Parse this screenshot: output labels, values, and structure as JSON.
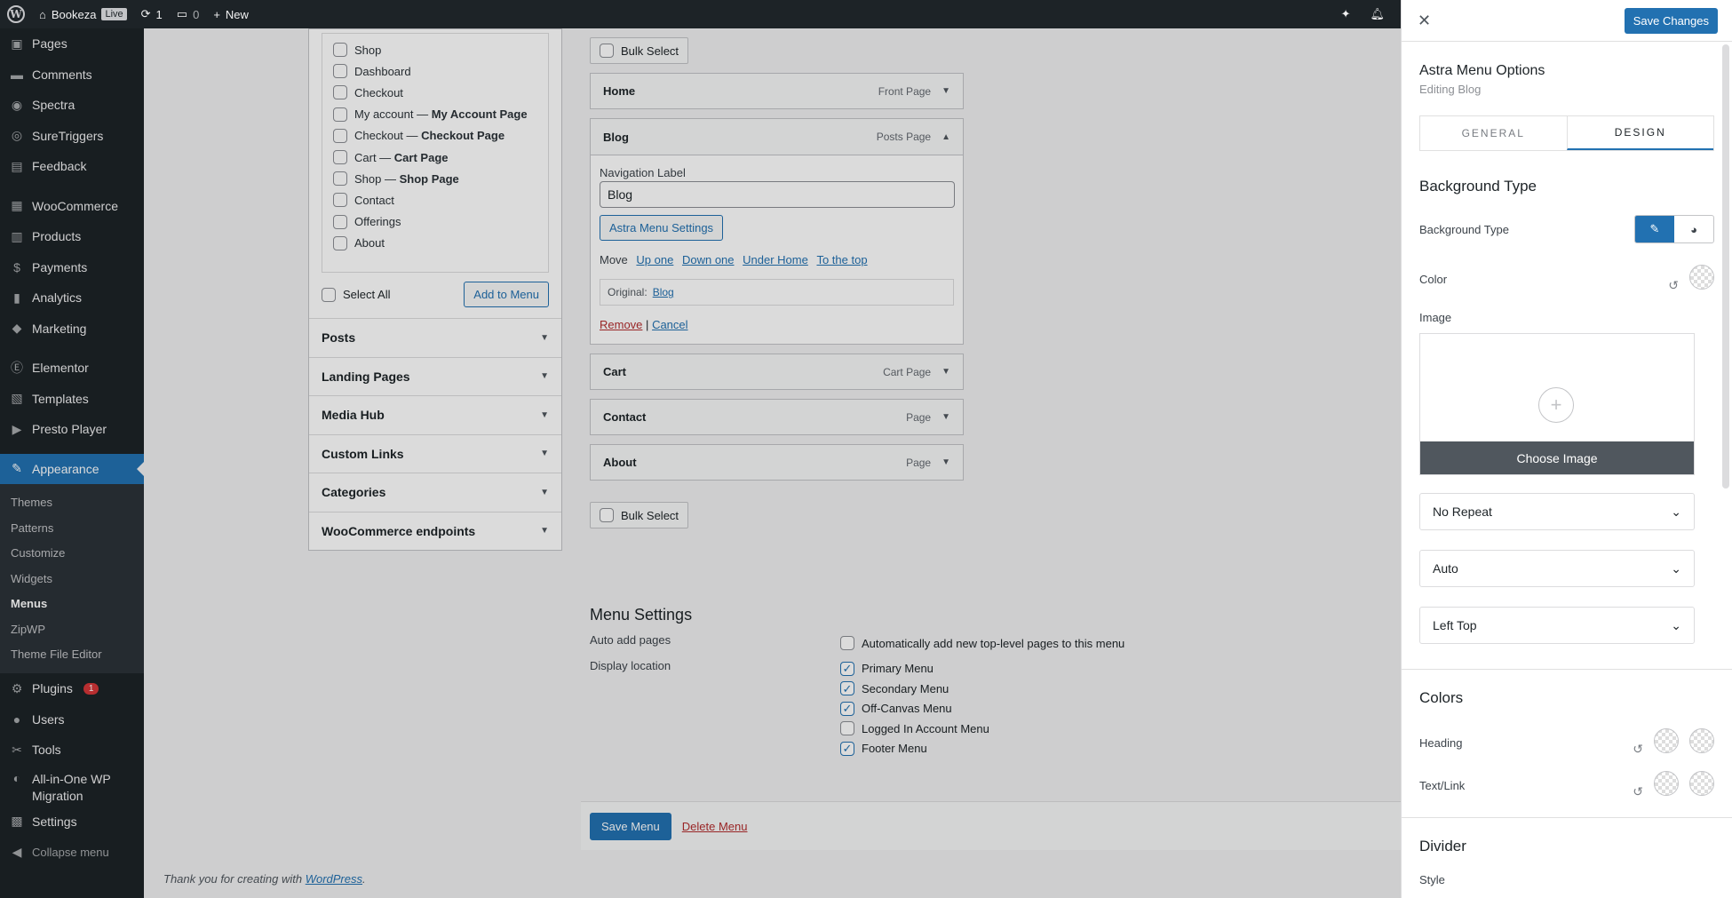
{
  "adminbar": {
    "site_name": "Bookeza",
    "live_label": "Live",
    "updates_count": "1",
    "comments_count": "0",
    "new_label": "New"
  },
  "sidebar": {
    "items_top": [
      "Pages",
      "Comments",
      "Spectra",
      "SureTriggers",
      "Feedback"
    ],
    "items_mid": [
      "WooCommerce",
      "Products",
      "Payments",
      "Analytics",
      "Marketing"
    ],
    "items_mid2": [
      "Elementor",
      "Templates",
      "Presto Player"
    ],
    "active": "Appearance",
    "submenu": [
      "Themes",
      "Patterns",
      "Customize",
      "Widgets",
      "Menus",
      "ZipWP",
      "Theme File Editor"
    ],
    "current_sub": "Menus",
    "plugins_label": "Plugins",
    "plugins_badge": "1",
    "users_label": "Users",
    "tools_label": "Tools",
    "aio_label_1": "All-in-One WP",
    "aio_label_2": "Migration",
    "settings_label": "Settings",
    "collapse_label": "Collapse menu"
  },
  "pages_box": {
    "items": [
      {
        "label": "Shop",
        "suffix": ""
      },
      {
        "label": "Dashboard",
        "suffix": ""
      },
      {
        "label": "Checkout",
        "suffix": ""
      },
      {
        "label": "My account — ",
        "suffix": "My Account Page"
      },
      {
        "label": "Checkout — ",
        "suffix": "Checkout Page"
      },
      {
        "label": "Cart — ",
        "suffix": "Cart Page"
      },
      {
        "label": "Shop — ",
        "suffix": "Shop Page"
      },
      {
        "label": "Contact",
        "suffix": ""
      },
      {
        "label": "Offerings",
        "suffix": ""
      },
      {
        "label": "About",
        "suffix": ""
      }
    ],
    "select_all": "Select All",
    "add_to_menu": "Add to Menu",
    "sections": [
      "Posts",
      "Landing Pages",
      "Media Hub",
      "Custom Links",
      "Categories",
      "WooCommerce endpoints"
    ]
  },
  "menu_structure": {
    "bulk_select": "Bulk Select",
    "home": {
      "label": "Home",
      "type": "Front Page"
    },
    "blog": {
      "label": "Blog",
      "type": "Posts Page"
    },
    "nav_label_title": "Navigation Label",
    "nav_label_value": "Blog",
    "astra_settings_btn": "Astra Menu Settings",
    "move_label": "Move",
    "move_links": [
      "Up one",
      "Down one",
      "Under Home",
      "To the top"
    ],
    "original_label": "Original:",
    "original_link": "Blog",
    "remove": "Remove",
    "sep": "|",
    "cancel": "Cancel",
    "others": [
      {
        "label": "Cart",
        "type": "Cart Page"
      },
      {
        "label": "Contact",
        "type": "Page"
      },
      {
        "label": "About",
        "type": "Page"
      }
    ]
  },
  "menu_settings": {
    "title": "Menu Settings",
    "auto_add_label": "Auto add pages",
    "auto_add_option": "Automatically add new top-level pages to this menu",
    "display_location_label": "Display location",
    "locations": [
      {
        "label": "Primary Menu",
        "checked": true
      },
      {
        "label": "Secondary Menu",
        "checked": true
      },
      {
        "label": "Off-Canvas Menu",
        "checked": true
      },
      {
        "label": "Logged In Account Menu",
        "checked": false
      },
      {
        "label": "Footer Menu",
        "checked": true
      }
    ],
    "save_menu": "Save Menu",
    "delete_menu": "Delete Menu"
  },
  "footer": {
    "thanks": "Thank you for creating with ",
    "wp_link": "WordPress",
    "dot": "."
  },
  "panel": {
    "save_changes": "Save Changes",
    "title": "Astra Menu Options",
    "subtitle": "Editing Blog",
    "tab_general": "GENERAL",
    "tab_design": "DESIGN",
    "bg_section": "Background Type",
    "bg_type_label": "Background Type",
    "color_label": "Color",
    "image_label": "Image",
    "choose_image": "Choose Image",
    "repeat_value": "No Repeat",
    "size_value": "Auto",
    "position_value": "Left Top",
    "colors_section": "Colors",
    "heading_label": "Heading",
    "textlink_label": "Text/Link",
    "divider_section": "Divider",
    "style_label": "Style"
  }
}
